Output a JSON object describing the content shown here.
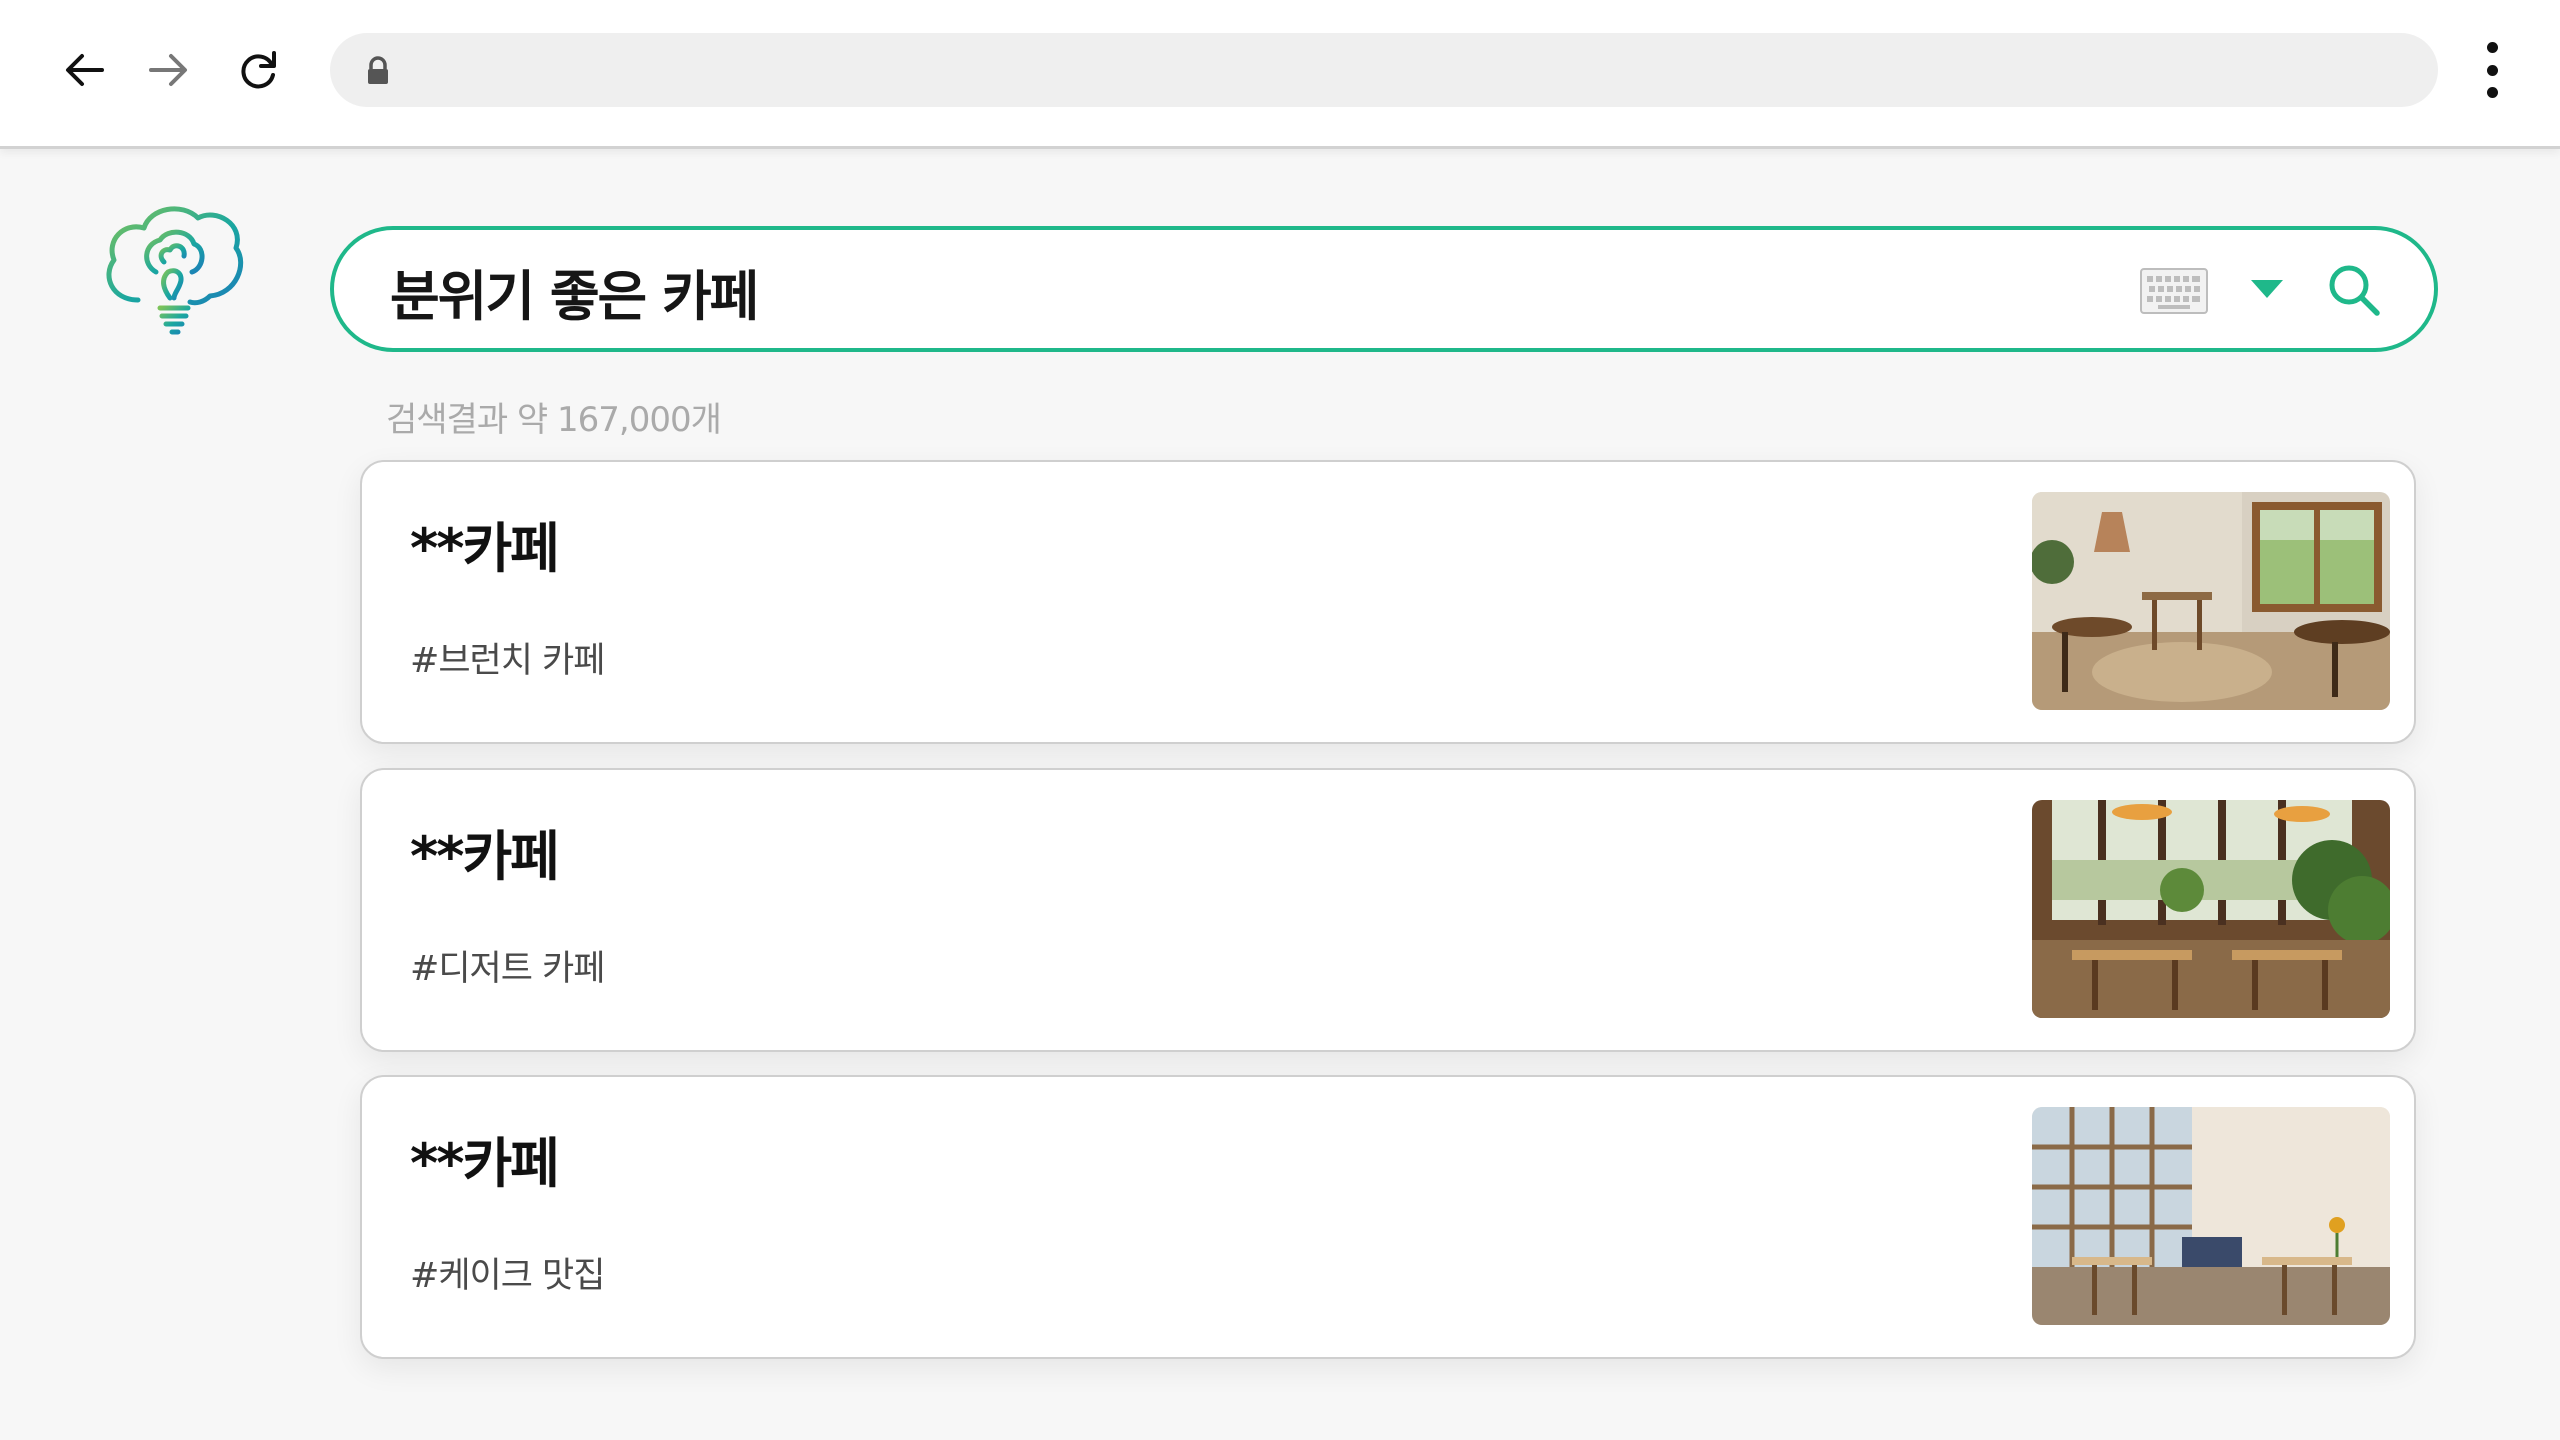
{
  "browser": {
    "url": "",
    "icons": [
      "back-icon",
      "forward-icon",
      "reload-icon",
      "lock-icon",
      "more-vert-icon"
    ]
  },
  "search": {
    "query": "분위기 좋은 카페",
    "icons": [
      "keyboard-icon",
      "caret-down-icon",
      "search-icon"
    ]
  },
  "results": {
    "count_text": "검색결과 약 167,000개",
    "items": [
      {
        "title": "**카페",
        "tag": "#브런치 카페"
      },
      {
        "title": "**카페",
        "tag": "#디저트 카페"
      },
      {
        "title": "**카페",
        "tag": "#케이크 맛집"
      }
    ]
  },
  "colors": {
    "accent": "#1fb88a",
    "logo_teal": "#1aa7a0",
    "background": "#f7f7f7"
  }
}
